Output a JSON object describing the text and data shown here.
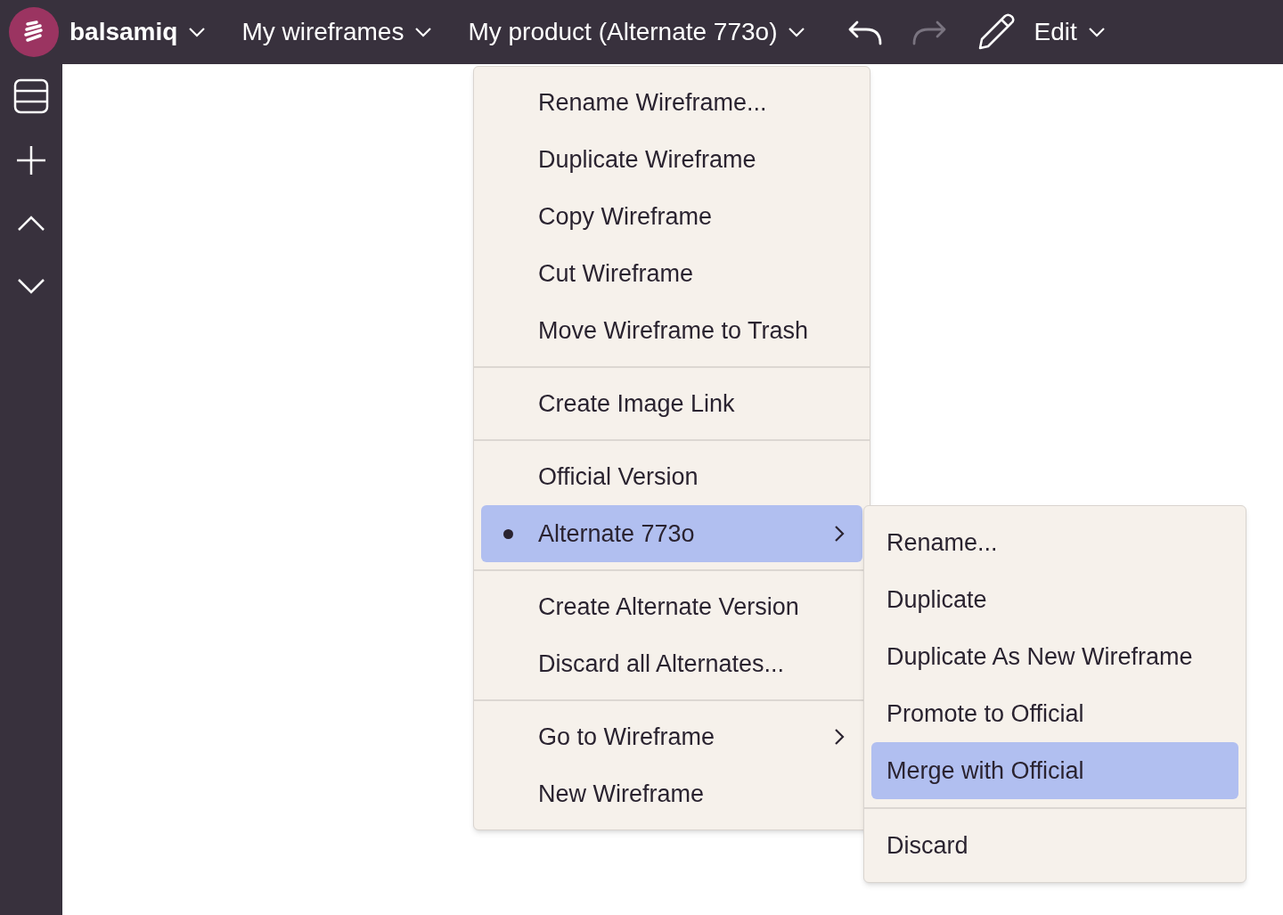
{
  "topbar": {
    "brand": "balsamiq",
    "nav": [
      {
        "label": "My wireframes"
      },
      {
        "label": "My product (Alternate 773o)"
      }
    ],
    "undo": {
      "disabled": false
    },
    "redo": {
      "disabled": true
    },
    "mode": "Edit"
  },
  "menu": {
    "groups": [
      {
        "items": [
          {
            "label": "Rename Wireframe...",
            "kind": "plain",
            "current": false,
            "selected": false
          },
          {
            "label": "Duplicate Wireframe",
            "kind": "plain",
            "current": false,
            "selected": false
          },
          {
            "label": "Copy Wireframe",
            "kind": "plain",
            "current": false,
            "selected": false
          },
          {
            "label": "Cut Wireframe",
            "kind": "plain",
            "current": false,
            "selected": false
          },
          {
            "label": "Move Wireframe to Trash",
            "kind": "plain",
            "current": false,
            "selected": false
          }
        ]
      },
      {
        "items": [
          {
            "label": "Create Image Link",
            "kind": "plain",
            "current": false,
            "selected": false
          }
        ]
      },
      {
        "items": [
          {
            "label": "Official Version",
            "kind": "plain",
            "current": false,
            "selected": false
          },
          {
            "label": "Alternate 773o",
            "kind": "submenu",
            "current": true,
            "selected": true
          }
        ]
      },
      {
        "items": [
          {
            "label": "Create Alternate Version",
            "kind": "plain",
            "current": false,
            "selected": false
          },
          {
            "label": "Discard all Alternates...",
            "kind": "plain",
            "current": false,
            "selected": false
          }
        ]
      },
      {
        "items": [
          {
            "label": "Go to Wireframe",
            "kind": "submenu",
            "current": false,
            "selected": false
          },
          {
            "label": "New Wireframe",
            "kind": "plain",
            "current": false,
            "selected": false
          }
        ]
      }
    ]
  },
  "submenu": {
    "groups": [
      {
        "items": [
          {
            "label": "Rename...",
            "selected": false
          },
          {
            "label": "Duplicate",
            "selected": false
          },
          {
            "label": "Duplicate As New Wireframe",
            "selected": false
          },
          {
            "label": "Promote to Official",
            "selected": false
          },
          {
            "label": "Merge with Official",
            "selected": true
          }
        ]
      },
      {
        "items": [
          {
            "label": "Discard",
            "selected": false
          }
        ]
      }
    ]
  }
}
